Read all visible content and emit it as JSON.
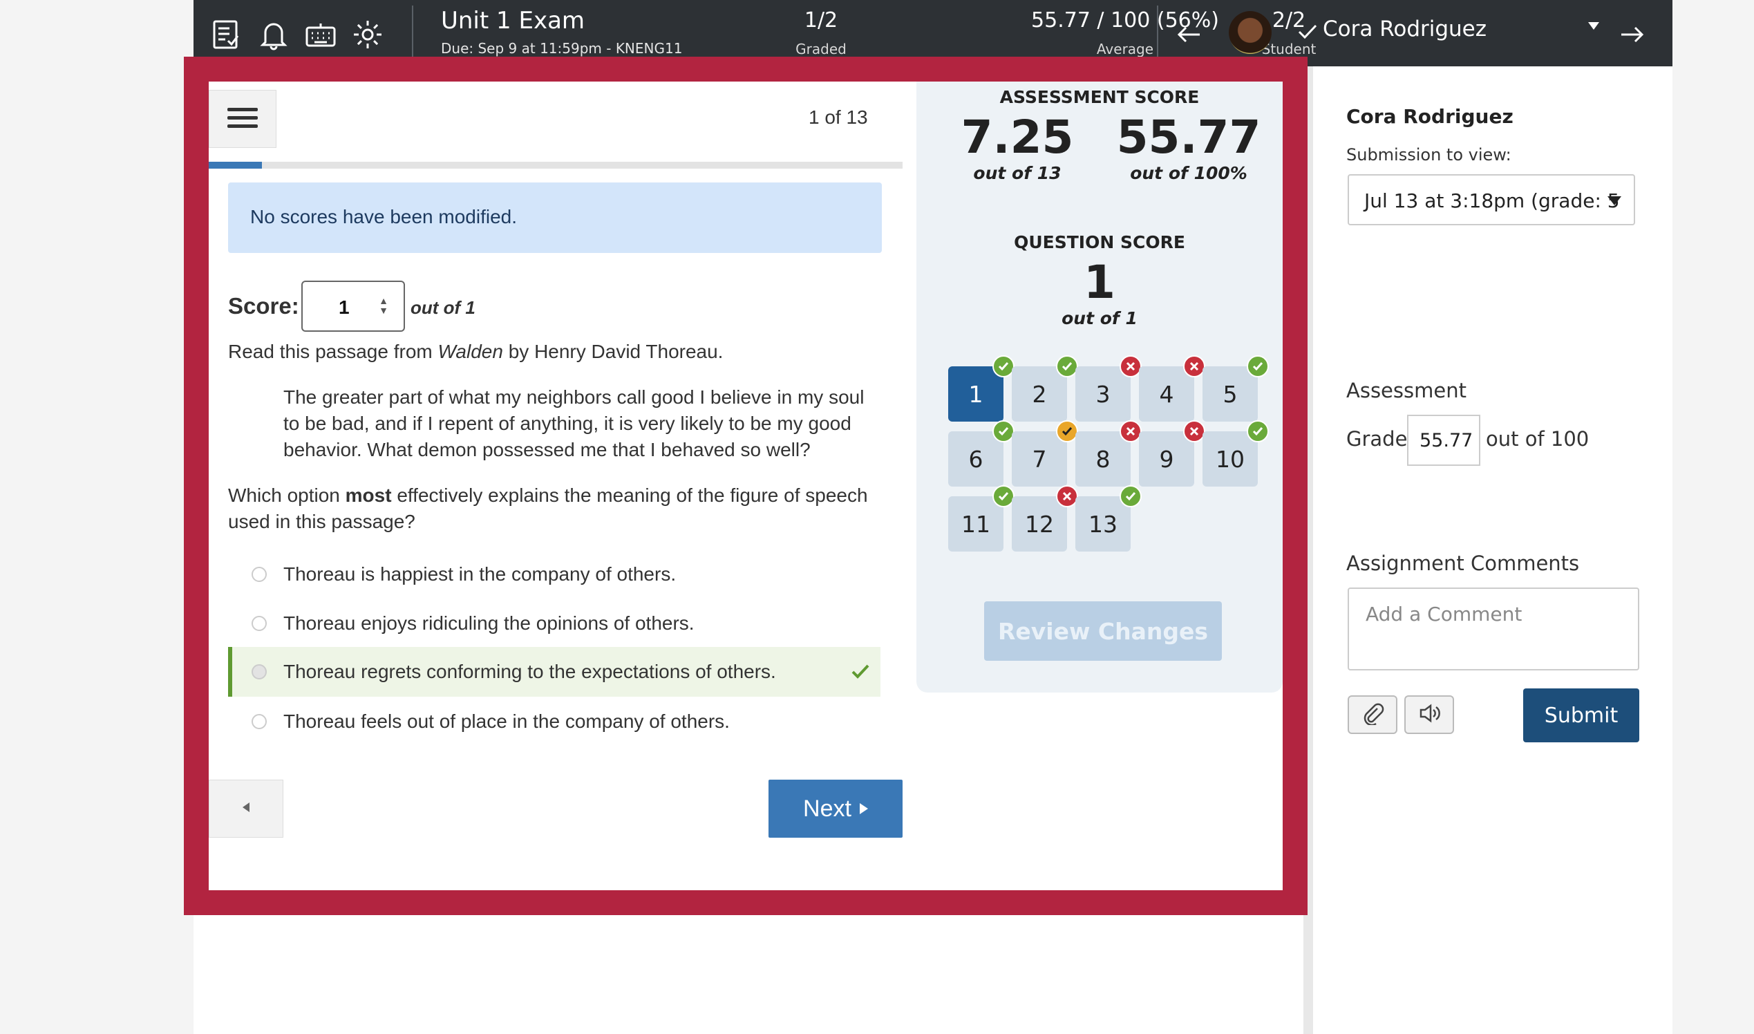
{
  "topbar": {
    "title": "Unit 1 Exam",
    "due": "Due: Sep 9 at 11:59pm - KNENG11",
    "stats": [
      {
        "value": "1/2",
        "label": "Graded"
      },
      {
        "value": "55.77 / 100 (56%)",
        "label": "Average"
      },
      {
        "value": "2/2",
        "label": "Student"
      }
    ],
    "student_name": "Cora Rodriguez",
    "icons": [
      "assignment-list-icon",
      "bell-icon",
      "keyboard-icon",
      "gear-icon",
      "arrow-left-icon",
      "checkmark-icon",
      "arrow-right-icon"
    ]
  },
  "question_panel": {
    "counter": "1 of 13",
    "progress_fraction": 0.077,
    "notice": "No scores have been modified.",
    "score_label": "Score:",
    "score_value": "1",
    "score_outof": "out of 1",
    "intro_before": "Read this passage from ",
    "intro_title": "Walden",
    "intro_after": " by Henry David Thoreau.",
    "passage": "The greater part of what my neighbors call good I believe in my soul to be bad, and if I repent of anything, it is very likely to be my good behavior. What demon possessed me that I behaved so well?",
    "question_before": "Which option ",
    "question_bold": "most",
    "question_after": " effectively explains the meaning of the figure of speech used in this passage?",
    "options": [
      {
        "text": "Thoreau is happiest in the company of others.",
        "correct": false
      },
      {
        "text": "Thoreau enjoys ridiculing the opinions of others.",
        "correct": false
      },
      {
        "text": "Thoreau regrets conforming to the expectations of others.",
        "correct": true
      },
      {
        "text": "Thoreau feels out of place in the company of others.",
        "correct": false
      }
    ],
    "next_label": "Next"
  },
  "score_panel": {
    "assessment_heading": "ASSESSMENT SCORE",
    "points": "7.25",
    "points_outof": "out of 13",
    "percent": "55.77",
    "percent_outof": "out of 100%",
    "question_heading": "QUESTION SCORE",
    "question_score": "1",
    "question_outof": "out of 1",
    "questions": [
      {
        "n": "1",
        "status": "ok"
      },
      {
        "n": "2",
        "status": "ok"
      },
      {
        "n": "3",
        "status": "bad"
      },
      {
        "n": "4",
        "status": "bad"
      },
      {
        "n": "5",
        "status": "ok"
      },
      {
        "n": "6",
        "status": "ok"
      },
      {
        "n": "7",
        "status": "partial"
      },
      {
        "n": "8",
        "status": "bad"
      },
      {
        "n": "9",
        "status": "bad"
      },
      {
        "n": "10",
        "status": "ok"
      },
      {
        "n": "11",
        "status": "ok"
      },
      {
        "n": "12",
        "status": "bad"
      },
      {
        "n": "13",
        "status": "ok"
      }
    ],
    "review_label": "Review Changes"
  },
  "right_panel": {
    "student_name": "Cora Rodriguez",
    "submission_label": "Submission to view:",
    "submission_value": "Jul 13 at 3:18pm (grade: 5",
    "assessment_label": "Assessment",
    "grade_label": "Grade",
    "grade_value": "55.77",
    "grade_outof": "out of 100",
    "comments_label": "Assignment Comments",
    "comment_placeholder": "Add a Comment",
    "submit_label": "Submit"
  },
  "colors": {
    "topbar": "#2d3135",
    "frame": "#b22440",
    "accent": "#3a78b6",
    "correct": "#6aaa3a",
    "incorrect": "#c8303c",
    "partial": "#e9a62a"
  }
}
